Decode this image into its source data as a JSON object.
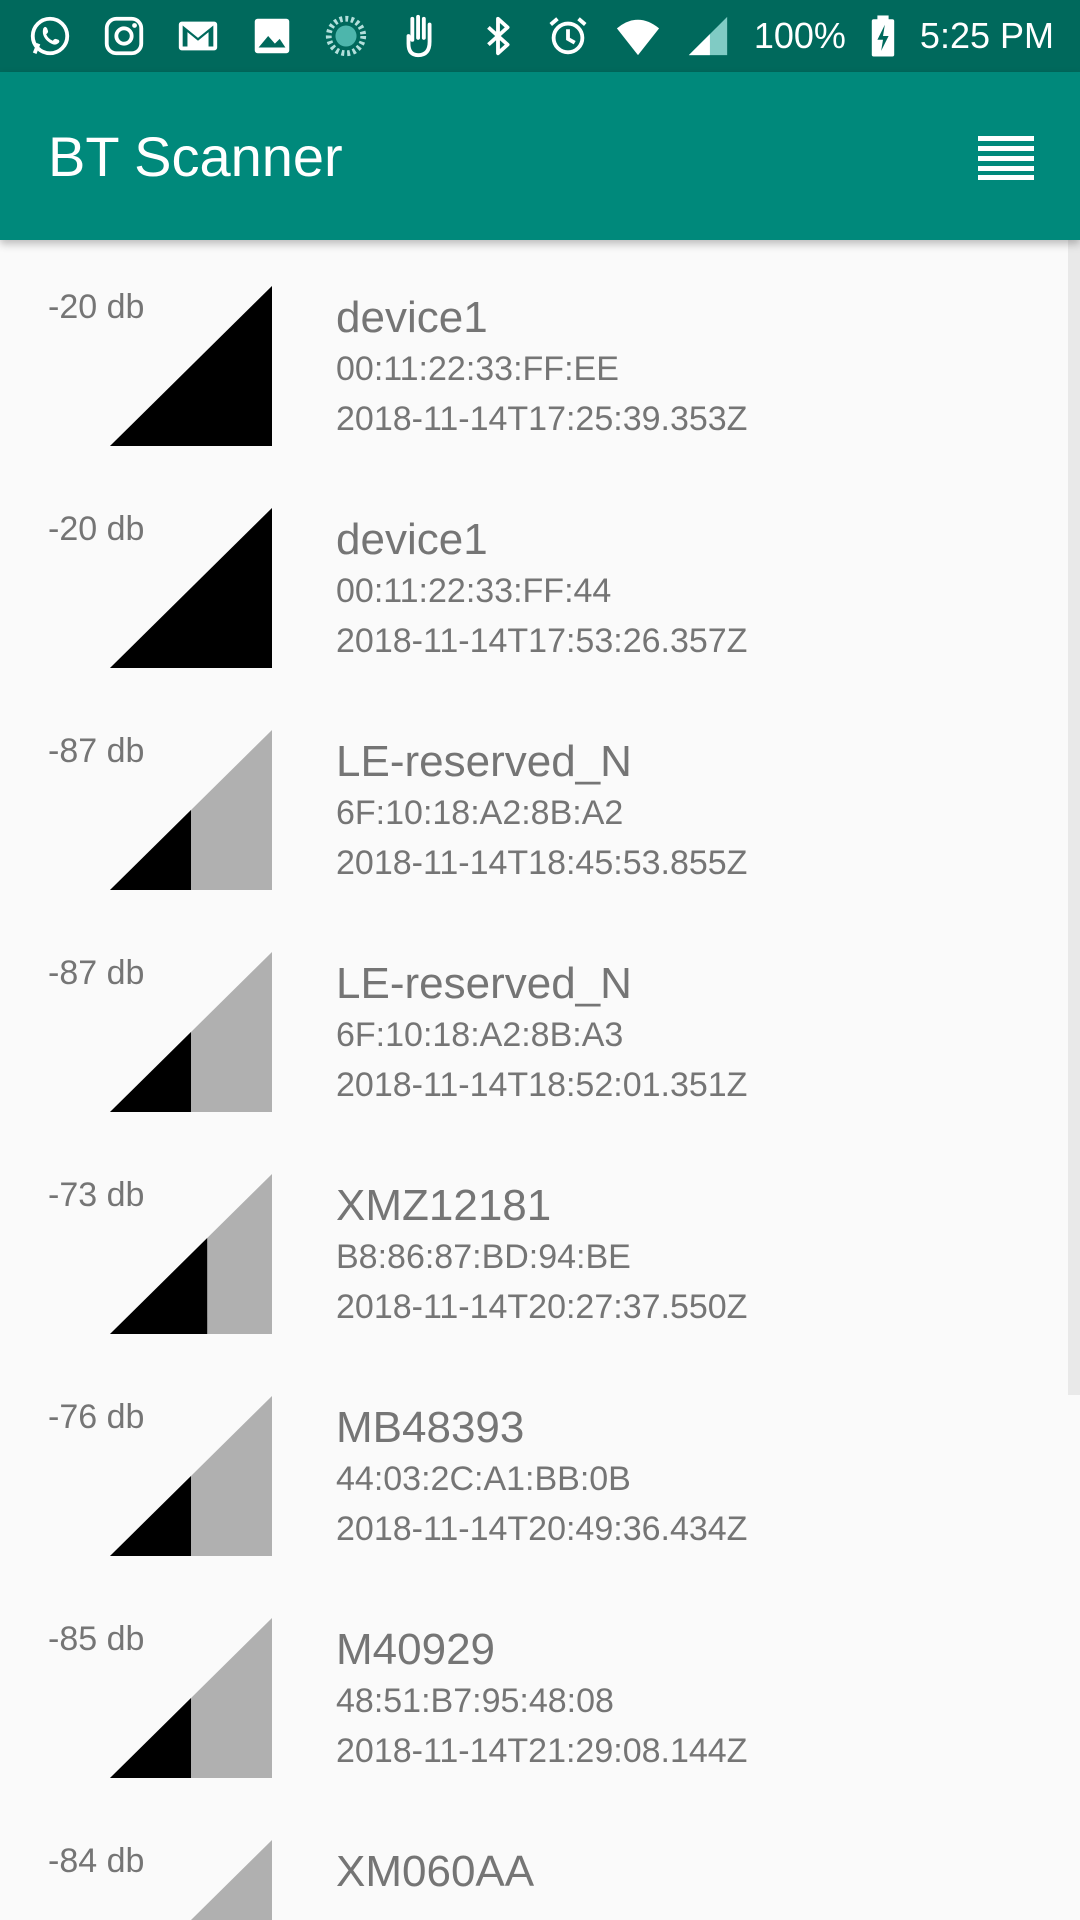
{
  "status_bar": {
    "left_icons": [
      "whatsapp-icon",
      "instagram-icon",
      "gmail-icon",
      "gallery-icon",
      "sync-icon",
      "hand-icon"
    ],
    "right_icons": [
      "bluetooth-icon",
      "alarm-icon",
      "wifi-icon",
      "cell-signal-icon",
      "battery-charging-icon"
    ],
    "battery": "100%",
    "time": "5:25 PM"
  },
  "app_bar": {
    "title": "BT Scanner",
    "menu_icon": "list-menu-icon"
  },
  "colors": {
    "status_bar": "#00695c",
    "app_bar": "#00897b",
    "text_secondary": "#757575",
    "signal_filled": "#000000",
    "signal_empty": "#b0b0b0"
  },
  "devices": [
    {
      "rssi": "-20 db",
      "name": "device1",
      "mac": "00:11:22:33:FF:EE",
      "timestamp": "2018-11-14T17:25:39.353Z",
      "signal_level": 1.0
    },
    {
      "rssi": "-20 db",
      "name": "device1",
      "mac": "00:11:22:33:FF:44",
      "timestamp": "2018-11-14T17:53:26.357Z",
      "signal_level": 1.0
    },
    {
      "rssi": "-87 db",
      "name": "LE-reserved_N",
      "mac": "6F:10:18:A2:8B:A2",
      "timestamp": "2018-11-14T18:45:53.855Z",
      "signal_level": 0.5
    },
    {
      "rssi": "-87 db",
      "name": "LE-reserved_N",
      "mac": "6F:10:18:A2:8B:A3",
      "timestamp": "2018-11-14T18:52:01.351Z",
      "signal_level": 0.5
    },
    {
      "rssi": "-73 db",
      "name": "XMZ12181",
      "mac": "B8:86:87:BD:94:BE",
      "timestamp": "2018-11-14T20:27:37.550Z",
      "signal_level": 0.6
    },
    {
      "rssi": "-76 db",
      "name": "MB48393",
      "mac": "44:03:2C:A1:BB:0B",
      "timestamp": "2018-11-14T20:49:36.434Z",
      "signal_level": 0.5
    },
    {
      "rssi": "-85 db",
      "name": "M40929",
      "mac": "48:51:B7:95:48:08",
      "timestamp": "2018-11-14T21:29:08.144Z",
      "signal_level": 0.5
    },
    {
      "rssi": "-84 db",
      "name": "XM060AA",
      "mac": "",
      "timestamp": "",
      "signal_level": 0.5
    }
  ]
}
